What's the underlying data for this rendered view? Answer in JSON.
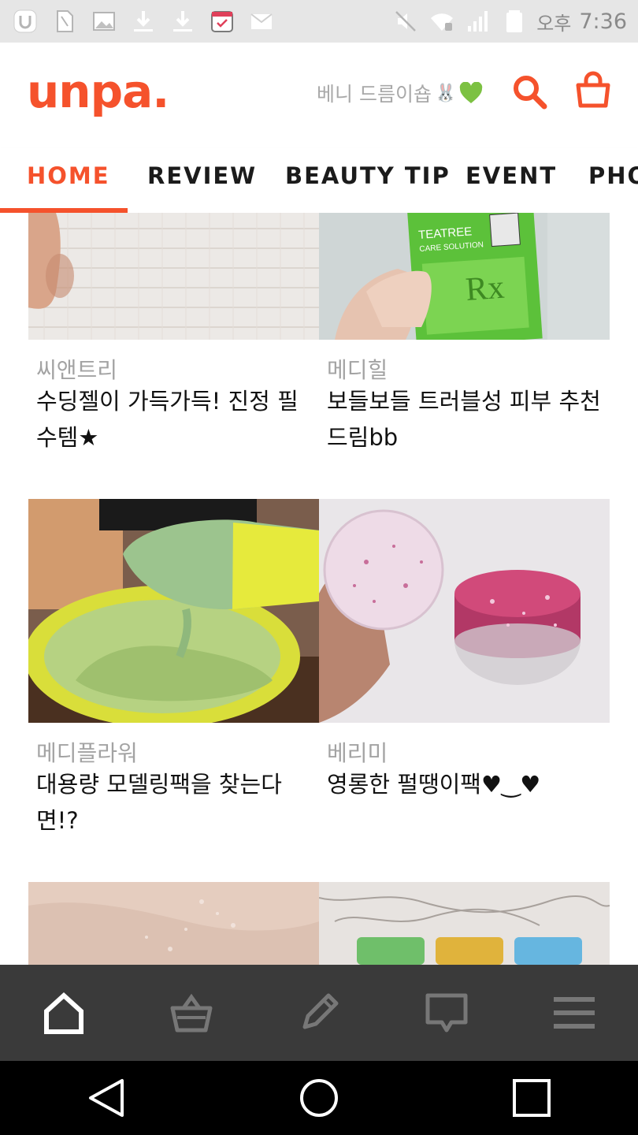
{
  "status_bar": {
    "ampm": "오후",
    "time": "7:36",
    "icons_left": [
      "u-app-icon",
      "sim-card-icon",
      "image-icon",
      "download-icon",
      "download-icon",
      "calendar-check-icon",
      "mail-icon"
    ],
    "icons_right": [
      "mute-icon",
      "wifi-icon",
      "signal-icon",
      "battery-icon"
    ]
  },
  "header": {
    "logo": "unpa.",
    "promo_text": "베니 드름이숍",
    "promo_emoji": "🐰",
    "heart_color": "#7cc142",
    "accent": "#f5522c"
  },
  "tabs": [
    {
      "label": "HOME",
      "active": true
    },
    {
      "label": "REVIEW",
      "active": false
    },
    {
      "label": "BEAUTY TIP",
      "active": false
    },
    {
      "label": "EVENT",
      "active": false
    },
    {
      "label": "PHO",
      "active": false
    }
  ],
  "cards": [
    {
      "brand": "씨앤트리",
      "title": "수딩젤이 가득가득! 진정 필수템★"
    },
    {
      "brand": "메디힐",
      "title": "보들보들 트러블성 피부 추천드림bb"
    },
    {
      "brand": "메디플라워",
      "title": "대용량 모델링팩을 찾는다면!?"
    },
    {
      "brand": "베리미",
      "title": "영롱한 펄땡이팩♥‿♥"
    },
    {
      "brand": "",
      "title": ""
    },
    {
      "brand": "",
      "title": ""
    }
  ],
  "thumbnail_text": {
    "teatree": "TEATREE",
    "care": "CARE SOLUTION"
  },
  "bottom_nav": [
    "home-icon",
    "basket-icon",
    "pencil-icon",
    "chat-icon",
    "menu-icon"
  ],
  "system_nav": [
    "back-icon",
    "home-circle-icon",
    "recents-icon"
  ]
}
